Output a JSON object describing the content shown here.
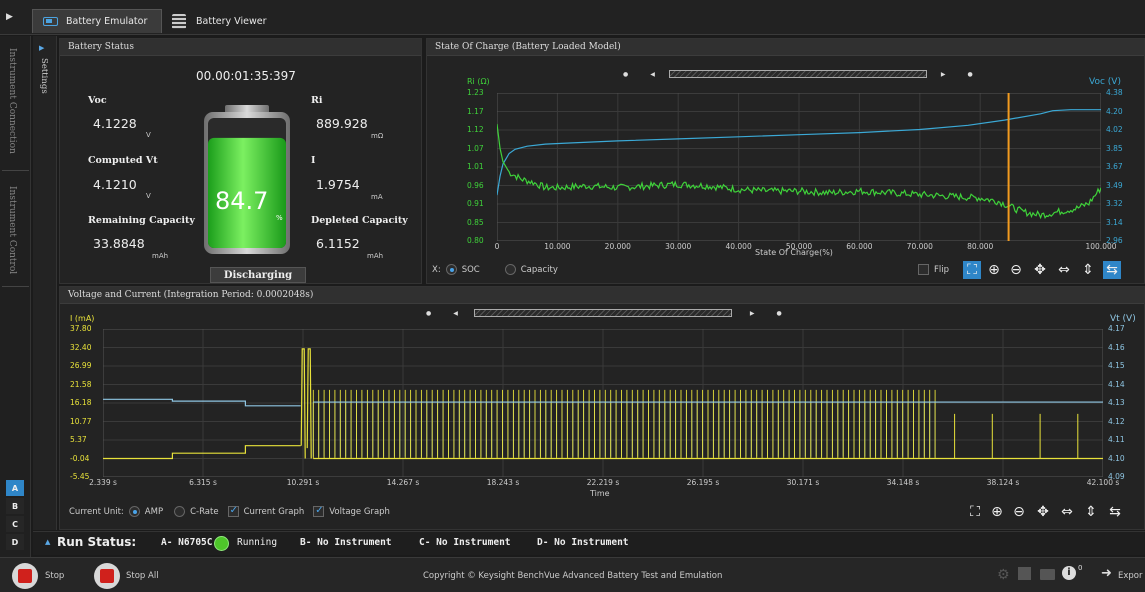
{
  "tabs": {
    "emulator": "Battery Emulator",
    "viewer": "Battery Viewer"
  },
  "sidebar": {
    "conn": "Instrument Connection",
    "control": "Instrument Control",
    "channels": [
      "A",
      "B",
      "C",
      "D"
    ],
    "settings": "Settings"
  },
  "status": {
    "title": "Battery Status",
    "timer": "00.00:01:35:397",
    "voc_label": "Voc",
    "voc": "4.1228",
    "voc_unit": "V",
    "vt_label": "Computed Vt",
    "vt": "4.1210",
    "vt_unit": "V",
    "rem_label": "Remaining Capacity",
    "rem": "33.8848",
    "rem_unit": "mAh",
    "ri_label": "Ri",
    "ri": "889.928",
    "ri_unit": "mΩ",
    "i_label": "I",
    "i": "1.9754",
    "i_unit": "mA",
    "dep_label": "Depleted Capacity",
    "dep": "6.1152",
    "dep_unit": "mAh",
    "percent": "84.7",
    "percent_unit": "%",
    "state": "Discharging"
  },
  "soc": {
    "title": "State Of Charge (Battery Loaded Model)",
    "left_axis": "Ri (Ω)",
    "right_axis": "Voc (V)",
    "x_axis": "State Of Charge(%)",
    "x_label": "X:",
    "opt_soc": "SOC",
    "opt_cap": "Capacity",
    "flip": "Flip",
    "chart_data": {
      "type": "line",
      "x_ticks": [
        "0",
        "10.000",
        "20.000",
        "30.000",
        "40.000",
        "50.000",
        "60.000",
        "70.000",
        "80.000",
        "100.000"
      ],
      "x_tick_values": [
        0,
        10,
        20,
        30,
        40,
        50,
        60,
        70,
        80,
        100
      ],
      "xlim": [
        0,
        100
      ],
      "left_ticks": [
        "1.23",
        "1.17",
        "1.12",
        "1.07",
        "1.01",
        "0.96",
        "0.91",
        "0.85",
        "0.80"
      ],
      "right_ticks": [
        "4.38",
        "4.20",
        "4.02",
        "3.85",
        "3.67",
        "3.49",
        "3.32",
        "3.14",
        "2.96"
      ],
      "ylim_left": [
        0.8,
        1.23
      ],
      "ylim_right": [
        2.96,
        4.38
      ],
      "cursor_x": 84.7,
      "series": [
        {
          "name": "Voc",
          "axis": "right",
          "color": "#3ba9d6",
          "x": [
            0,
            0.5,
            1,
            2,
            3,
            5,
            8,
            12,
            20,
            30,
            40,
            50,
            60,
            70,
            78,
            84,
            90,
            92,
            95,
            100
          ],
          "y": [
            3.4,
            3.58,
            3.7,
            3.8,
            3.84,
            3.87,
            3.89,
            3.9,
            3.92,
            3.94,
            3.96,
            3.98,
            4.0,
            4.03,
            4.07,
            4.12,
            4.18,
            4.21,
            4.22,
            4.22
          ]
        },
        {
          "name": "Ri",
          "axis": "left",
          "color": "#3fd23a",
          "x": [
            0,
            0.5,
            1,
            2,
            4,
            6,
            8,
            10,
            15,
            20,
            25,
            30,
            35,
            40,
            45,
            50,
            55,
            60,
            65,
            70,
            75,
            80,
            83,
            85,
            87,
            90,
            93,
            96,
            98,
            100
          ],
          "y": [
            1.14,
            1.07,
            1.03,
            1.0,
            0.98,
            0.97,
            0.955,
            0.955,
            0.96,
            0.955,
            0.96,
            0.965,
            0.96,
            0.95,
            0.945,
            0.945,
            0.94,
            0.945,
            0.94,
            0.935,
            0.93,
            0.925,
            0.915,
            0.9,
            0.885,
            0.875,
            0.885,
            0.895,
            0.91,
            0.955
          ]
        }
      ]
    }
  },
  "vc": {
    "title": "Voltage and Current (Integration Period: 0.0002048s)",
    "left_axis": "I (mA)",
    "right_axis": "Vt (V)",
    "x_axis": "Time",
    "current_unit": "Current Unit:",
    "amp": "AMP",
    "crate": "C-Rate",
    "cur_graph": "Current Graph",
    "volt_graph": "Voltage Graph",
    "chart_data": {
      "type": "line",
      "x_ticks": [
        "2.339 s",
        "6.315 s",
        "10.291 s",
        "14.267 s",
        "18.243 s",
        "22.219 s",
        "26.195 s",
        "30.171 s",
        "34.148 s",
        "38.124 s",
        "42.100 s"
      ],
      "x_tick_values": [
        2.339,
        6.315,
        10.291,
        14.267,
        18.243,
        22.219,
        26.195,
        30.171,
        34.148,
        38.124,
        42.1
      ],
      "xlim": [
        2.339,
        42.1
      ],
      "left_ticks": [
        "37.80",
        "32.40",
        "26.99",
        "21.58",
        "16.18",
        "10.77",
        "5.37",
        "-0.04",
        "-5.45"
      ],
      "right_ticks": [
        "4.17",
        "4.16",
        "4.15",
        "4.14",
        "4.13",
        "4.12",
        "4.11",
        "4.10",
        "4.09"
      ],
      "ylim_left": [
        -5.45,
        37.8
      ],
      "ylim_right": [
        4.09,
        4.17
      ],
      "pulse_start": 10.7,
      "pulse_end": 35.6,
      "pulse_period": 0.215,
      "series": [
        {
          "name": "I",
          "axis": "left",
          "color": "#e8e23a",
          "base_segments": [
            {
              "x": [
                2.339,
                5.1
              ],
              "y": -0.04
            },
            {
              "x": [
                5.1,
                8.0
              ],
              "y": 1.5
            },
            {
              "x": [
                8.0,
                10.2
              ],
              "y": 3.7
            }
          ],
          "pulse_peak": 20.0,
          "pulse_base": -0.04,
          "spike": 32.0
        },
        {
          "name": "Vt",
          "axis": "right",
          "color": "#8fc6e3",
          "base_segments": [
            {
              "x": [
                2.339,
                5.1
              ],
              "y": 4.132
            },
            {
              "x": [
                5.1,
                8.0
              ],
              "y": 4.131
            },
            {
              "x": [
                8.0,
                10.2
              ],
              "y": 4.1285
            }
          ],
          "pulse_top": 4.1305,
          "pulse_min": 4.101,
          "tail": 4.1305
        }
      ]
    }
  },
  "run": {
    "label": "Run Status:",
    "a": "A- N6705C",
    "running": "Running",
    "b": "B- No Instrument",
    "c": "C- No Instrument",
    "d": "D- No Instrument"
  },
  "bottom": {
    "stop": "Stop",
    "stop_all": "Stop All",
    "copyright": "Copyright © Keysight BenchVue Advanced Battery Test and Emulation",
    "export": "Expor",
    "badge": "0"
  },
  "colors": {
    "accent": "#2f86c8",
    "voc": "#3ba9d6",
    "ri": "#3fd23a",
    "current": "#e8e23a",
    "vt": "#8fc6e3",
    "cursor": "#f29b1f",
    "stop": "#d0211c",
    "running": "#4ec62a"
  }
}
